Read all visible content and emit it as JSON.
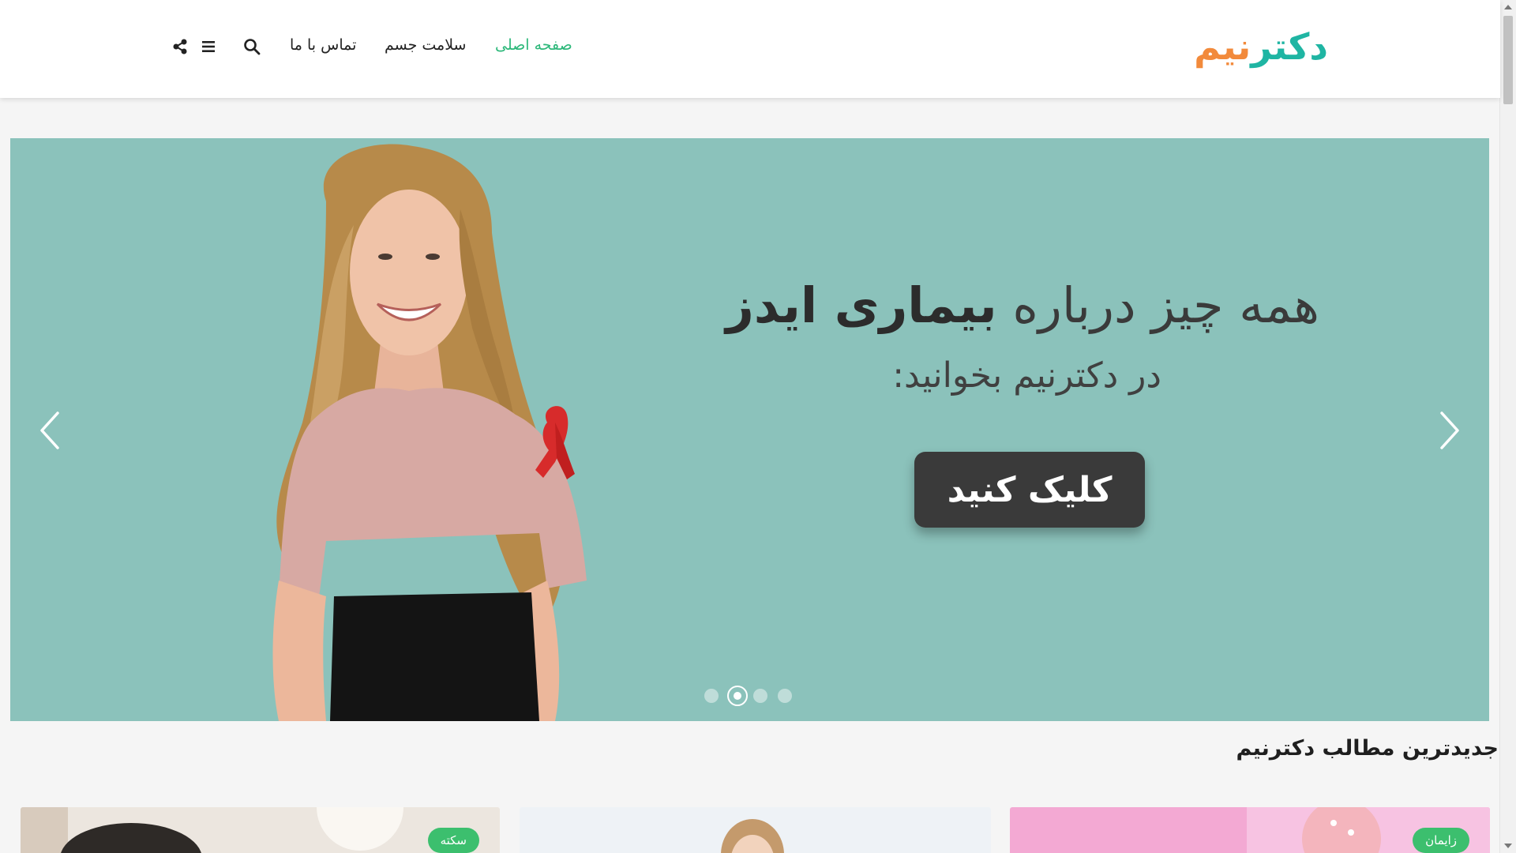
{
  "header": {
    "logo": {
      "part1": "دکتر",
      "part2": "نیم"
    },
    "nav": [
      {
        "label": "صفحه اصلی",
        "active": true
      },
      {
        "label": "سلامت جسم",
        "active": false
      },
      {
        "label": "تماس با ما",
        "active": false
      }
    ],
    "icons": [
      "search-icon",
      "menu-icon",
      "share-icon"
    ]
  },
  "slider": {
    "title_regular": "همه چیز درباره ",
    "title_bold": "بیماری ایدز",
    "subtitle": "در دکترنیم بخوانید:",
    "button_label": "کلیک کنید",
    "background": "#8bc2bb",
    "dots_count": 4,
    "active_dot": 2
  },
  "latest": {
    "title": "جدیدترین مطالب دکترنیم",
    "cards": [
      {
        "badge": "زایمان"
      },
      {
        "badge": ""
      },
      {
        "badge": "سکته"
      }
    ]
  },
  "colors": {
    "accent": "#2db87a",
    "logo_teal": "#1fb5a3",
    "logo_orange": "#f28a3b",
    "button": "#3a3a3a"
  }
}
